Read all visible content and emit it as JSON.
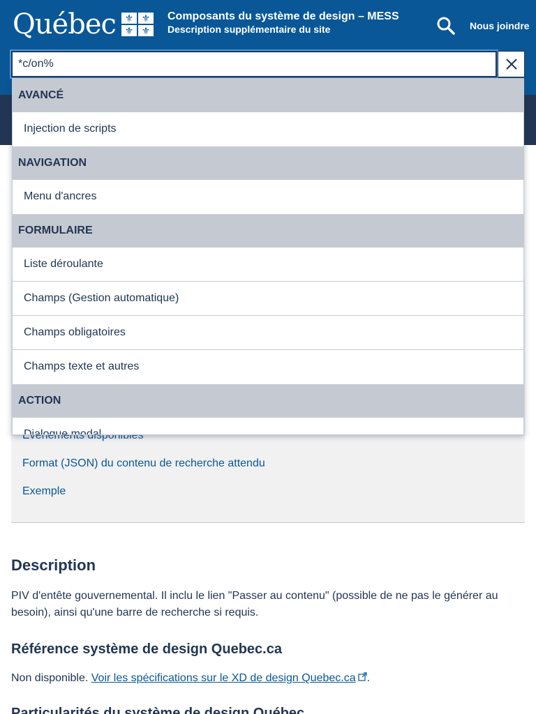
{
  "header": {
    "logo_text": "Québec",
    "site_title": "Composants du système de design – MESS",
    "site_description": "Description supplémentaire du site",
    "contact_label": "Nous joindre",
    "search_icon": "search-icon"
  },
  "search": {
    "value": "*c/on%",
    "clear_icon": "close-icon"
  },
  "dropdown": {
    "groups": [
      {
        "label": "AVANCÉ",
        "items": [
          "Injection de scripts"
        ]
      },
      {
        "label": "NAVIGATION",
        "items": [
          "Menu d'ancres"
        ]
      },
      {
        "label": "FORMULAIRE",
        "items": [
          "Liste déroulante",
          "Champs (Gestion automatique)",
          "Champs obligatoires",
          "Champs texte et autres"
        ]
      },
      {
        "label": "ACTION",
        "items": [
          "Dialogue modal"
        ]
      }
    ]
  },
  "toc": {
    "links": [
      "Événements disponibles",
      "Format (JSON) du contenu de recherche attendu",
      "Exemple"
    ]
  },
  "content": {
    "description_heading": "Description",
    "description_text": "PIV d'entête gouvernemental. Il inclu le lien \"Passer au contenu\" (possible de ne pas le générer au besoin), ainsi qu'une barre de recherche si requis.",
    "reference_heading": "Référence système de design Quebec.ca",
    "reference_prefix": "Non disponible.",
    "reference_link": "Voir les spécifications sur le XD de design Quebec.ca",
    "reference_suffix": ".",
    "next_heading": "Particularités du système de design Québec"
  },
  "colors": {
    "brand_blue": "#095797",
    "dark_blue": "#223654",
    "group_grey": "#c5cad2",
    "panel_grey": "#f1f1f2"
  }
}
